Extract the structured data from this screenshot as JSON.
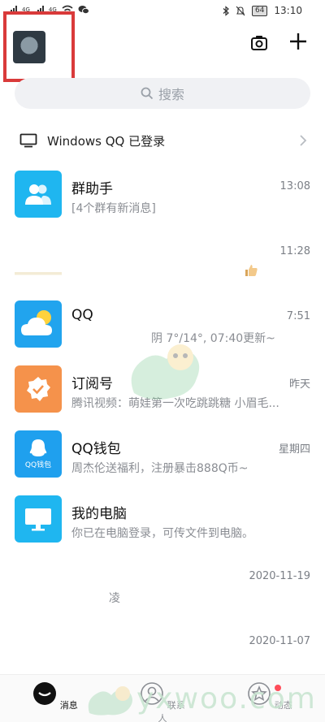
{
  "status_bar": {
    "left_labels": [
      "4G",
      "4G"
    ],
    "battery": "64",
    "time": "13:10"
  },
  "search": {
    "placeholder": "搜索"
  },
  "login_banner": {
    "text": "Windows QQ 已登录"
  },
  "conversations": [
    {
      "title": "群助手",
      "subtitle": "[4个群有新消息]",
      "time": "13:08",
      "icon": "group-assistant-icon",
      "color": "#1fb6f0"
    },
    {
      "title": "",
      "subtitle": "",
      "time": "11:28",
      "icon": "thumbs-up-icon",
      "color": "#ffffff"
    },
    {
      "title": "QQ",
      "subtitle": "阴 7°/14°, 07:40更新~",
      "time": "7:51",
      "icon": "weather-icon",
      "color": "#21a4ee"
    },
    {
      "title": "订阅号",
      "subtitle": "腾讯视频：萌娃第一次吃跳跳糖 小眉毛...",
      "time": "昨天",
      "icon": "subscription-badge-icon",
      "color": "#f5924b"
    },
    {
      "title": "QQ钱包",
      "subtitle": "周杰伦送福利，注册暴击888Q币~",
      "time": "星期四",
      "icon": "qq-wallet-icon",
      "color": "#1fa0ee",
      "icon_label": "QQ钱包"
    },
    {
      "title": "我的电脑",
      "subtitle": "你已在电脑登录，可传文件到电脑。",
      "time": "",
      "icon": "my-computer-icon",
      "color": "#1fb6f0"
    },
    {
      "title": "",
      "subtitle": "凌",
      "time": "2020-11-19",
      "icon": "",
      "color": "#ffffff"
    },
    {
      "title": "",
      "subtitle": "",
      "time": "2020-11-07",
      "icon": "",
      "color": "#ffffff"
    }
  ],
  "tabs": [
    {
      "label": "消息",
      "icon": "message-icon",
      "active": true
    },
    {
      "label": "联系人",
      "icon": "contacts-icon",
      "active": false
    },
    {
      "label": "动态",
      "icon": "star-icon",
      "active": false,
      "badge": true
    }
  ],
  "watermark": {
    "text": "yxwoo.com"
  }
}
